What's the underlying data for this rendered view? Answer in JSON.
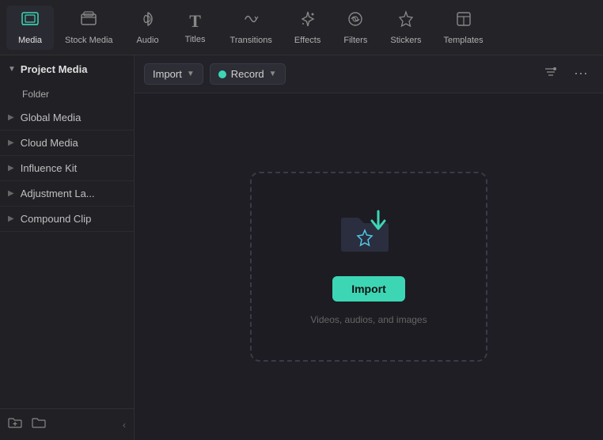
{
  "toolbar": {
    "items": [
      {
        "id": "media",
        "label": "Media",
        "icon": "🖼",
        "active": true
      },
      {
        "id": "stock-media",
        "label": "Stock Media",
        "icon": "📦",
        "active": false
      },
      {
        "id": "audio",
        "label": "Audio",
        "icon": "♪",
        "active": false
      },
      {
        "id": "titles",
        "label": "Titles",
        "icon": "T",
        "active": false
      },
      {
        "id": "transitions",
        "label": "Transitions",
        "icon": "⟳",
        "active": false
      },
      {
        "id": "effects",
        "label": "Effects",
        "icon": "✦",
        "active": false
      },
      {
        "id": "filters",
        "label": "Filters",
        "icon": "◈",
        "active": false
      },
      {
        "id": "stickers",
        "label": "Stickers",
        "icon": "✿",
        "active": false
      },
      {
        "id": "templates",
        "label": "Templates",
        "icon": "⊟",
        "active": false
      }
    ]
  },
  "sidebar": {
    "project_media_label": "Project Media",
    "folder_label": "Folder",
    "items": [
      {
        "id": "global-media",
        "label": "Global Media"
      },
      {
        "id": "cloud-media",
        "label": "Cloud Media"
      },
      {
        "id": "influence-kit",
        "label": "Influence Kit"
      },
      {
        "id": "adjustment-la",
        "label": "Adjustment La..."
      },
      {
        "id": "compound-clip",
        "label": "Compound Clip"
      }
    ]
  },
  "content": {
    "import_label": "Import",
    "record_label": "Record",
    "filter_icon": "⊟",
    "more_icon": "⋯",
    "drop_zone": {
      "import_btn_label": "Import",
      "hint": "Videos, audios, and images"
    }
  },
  "bottom": {
    "new_folder_icon": "⊞",
    "import_icon": "⊟",
    "collapse_icon": "‹"
  }
}
